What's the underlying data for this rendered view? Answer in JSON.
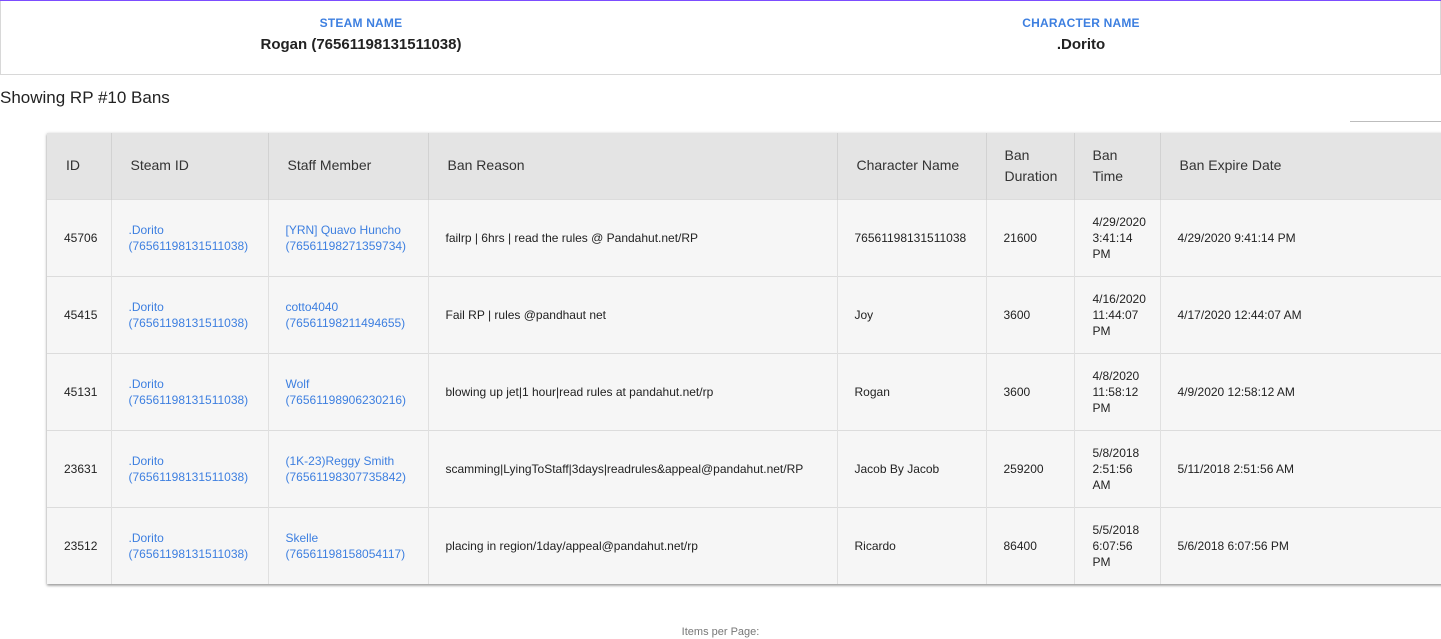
{
  "profile": {
    "steam_label": "STEAM NAME",
    "steam_value": "Rogan (76561198131511038)",
    "character_label": "CHARACTER NAME",
    "character_value": ".Dorito"
  },
  "heading": "Showing RP #10 Bans",
  "search": {
    "value": ""
  },
  "table": {
    "headers": {
      "id": "ID",
      "steam_id": "Steam ID",
      "staff": "Staff Member",
      "reason": "Ban Reason",
      "character": "Character Name",
      "duration_1": "Ban",
      "duration_2": "Duration",
      "time_1": "Ban",
      "time_2": "Time",
      "expire": "Ban Expire Date"
    },
    "rows": [
      {
        "id": "45706",
        "steam_name": ".Dorito",
        "steam_id": "(76561198131511038)",
        "staff_name": "[YRN] Quavo Huncho",
        "staff_id": "(76561198271359734)",
        "reason": "failrp | 6hrs | read the rules @ Pandahut.net/RP",
        "character": "76561198131511038",
        "duration": "21600",
        "time_date": "4/29/2020",
        "time_clock": "3:41:14",
        "time_ampm": "PM",
        "expire": "4/29/2020 9:41:14 PM"
      },
      {
        "id": "45415",
        "steam_name": ".Dorito",
        "steam_id": "(76561198131511038)",
        "staff_name": "cotto4040",
        "staff_id": "(76561198211494655)",
        "reason": "Fail RP | rules @pandhaut net",
        "character": "Joy",
        "duration": "3600",
        "time_date": "4/16/2020",
        "time_clock": "11:44:07",
        "time_ampm": "PM",
        "expire": "4/17/2020 12:44:07 AM"
      },
      {
        "id": "45131",
        "steam_name": ".Dorito",
        "steam_id": "(76561198131511038)",
        "staff_name": "Wolf",
        "staff_id": "(76561198906230216)",
        "reason": "blowing up jet|1 hour|read rules at pandahut.net/rp",
        "character": "Rogan",
        "duration": "3600",
        "time_date": "4/8/2020",
        "time_clock": "11:58:12",
        "time_ampm": "PM",
        "expire": "4/9/2020 12:58:12 AM"
      },
      {
        "id": "23631",
        "steam_name": ".Dorito",
        "steam_id": "(76561198131511038)",
        "staff_name": "(1K-23)Reggy Smith",
        "staff_id": "(76561198307735842)",
        "reason": "scamming|LyingToStaff|3days|readrules&appeal@pandahut.net/RP",
        "character": "Jacob By Jacob",
        "duration": "259200",
        "time_date": "5/8/2018",
        "time_clock": "2:51:56",
        "time_ampm": "AM",
        "expire": "5/11/2018 2:51:56 AM"
      },
      {
        "id": "23512",
        "steam_name": ".Dorito",
        "steam_id": "(76561198131511038)",
        "staff_name": "Skelle",
        "staff_id": "(76561198158054117)",
        "reason": "placing in region/1day/appeal@pandahut.net/rp",
        "character": "Ricardo",
        "duration": "86400",
        "time_date": "5/5/2018",
        "time_clock": "6:07:56",
        "time_ampm": "PM",
        "expire": "5/6/2018 6:07:56 PM"
      }
    ]
  },
  "pagination": {
    "items_per_page_label": "Items per Page:"
  },
  "colors": {
    "accent": "#3d7fe0",
    "top_border": "#7c4dff"
  }
}
